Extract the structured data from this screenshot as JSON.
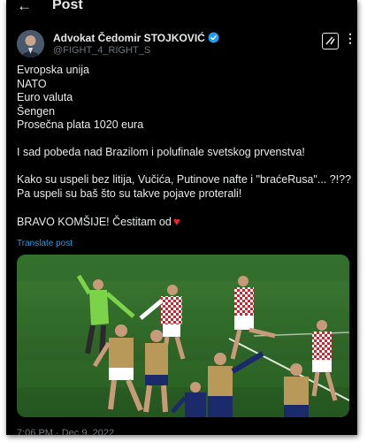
{
  "header": {
    "title": "Post"
  },
  "author": {
    "display_name": "Advokat Čedomir STOJKOVIĆ",
    "handle": "@FIGHT_4_RIGHT_S"
  },
  "post": {
    "list_lines": [
      "Evropska unija",
      "NATO",
      "Euro valuta",
      "Šengen",
      "Prosečna plata 1020 eura"
    ],
    "line_victory": "I sad pobeda nad Brazilom i polufinale svetskog prvenstva!",
    "line_how_1": "Kako su uspeli bez litija, Vučića, Putinove nafte i \"braćeRusa\"... ?!??",
    "line_how_2": "Pa uspeli su baš što su takve pojave proterali!",
    "line_bravo": "BRAVO KOMŠIJE! Čestitam od",
    "heart_glyph": "♥",
    "translate_label": "Translate post"
  },
  "timestamp": "7:06 PM · Dec 9, 2022",
  "colors": {
    "background": "#000000",
    "text": "#e7e9ea",
    "secondary": "#71767b",
    "link": "#1d9bf0",
    "heart": "#f4212e",
    "pitch": "#2f6e2a"
  },
  "icons": {
    "back": "back-arrow-icon",
    "verified": "verified-badge-icon",
    "grok": "grok-icon",
    "more": "more-icon",
    "heart": "heart-icon"
  }
}
